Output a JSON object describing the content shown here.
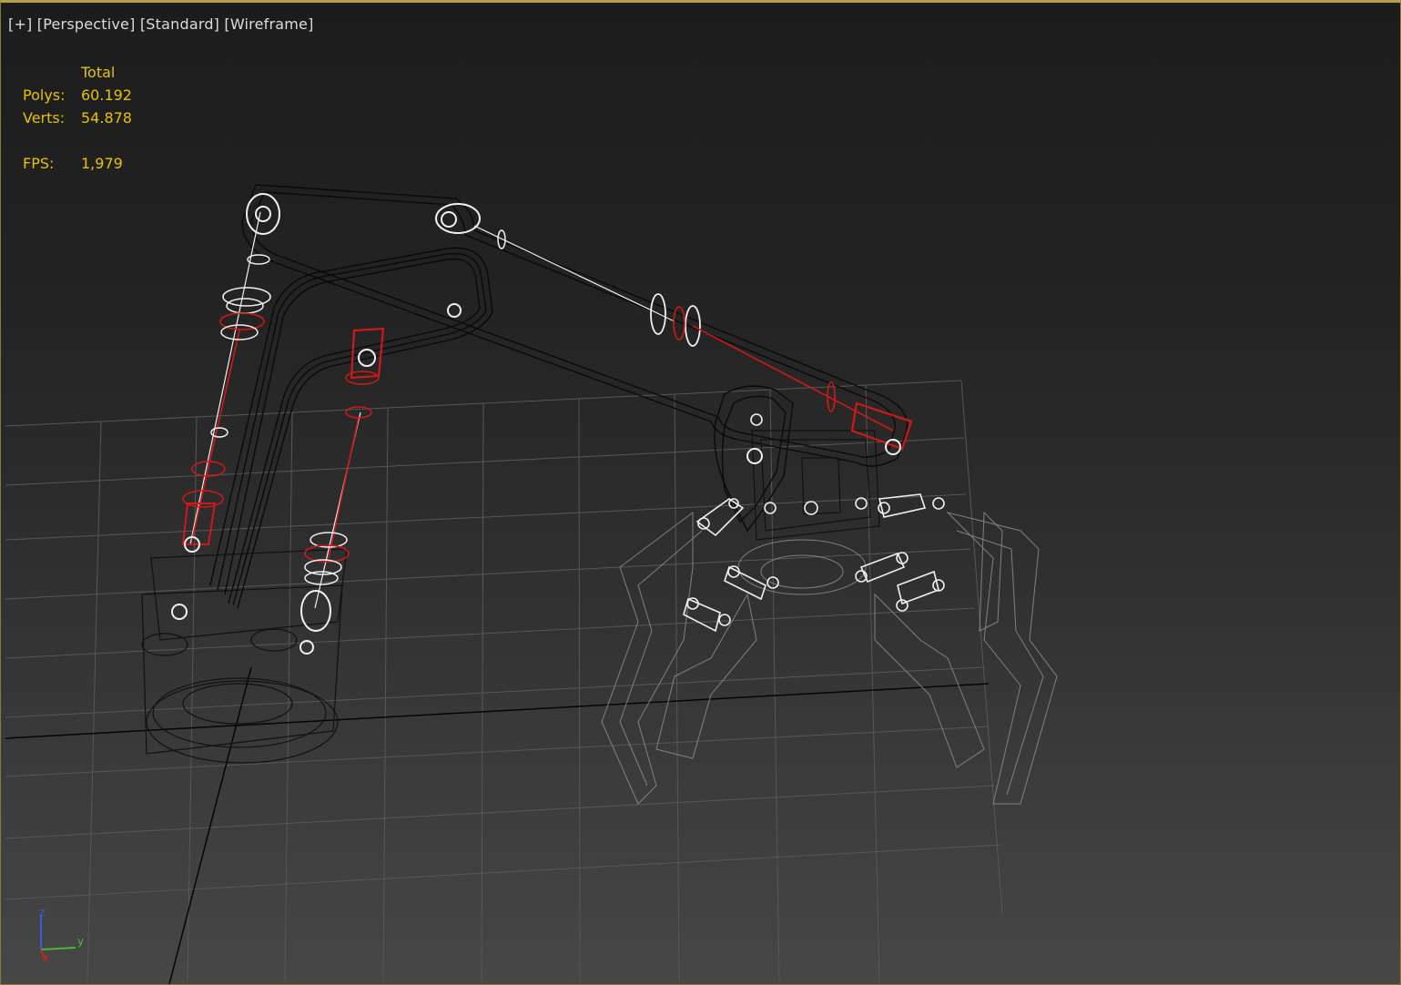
{
  "viewport": {
    "label_plus": "[+]",
    "label_view": "[Perspective]",
    "label_shading": "[Standard]",
    "label_mode": "[Wireframe]"
  },
  "stats": {
    "header": "Total",
    "polys_label": "Polys:",
    "polys_value": "60.192",
    "verts_label": "Verts:",
    "verts_value": "54.878",
    "fps_label": "FPS:",
    "fps_value": "1,979"
  },
  "axis_gizmo": {
    "z": "z",
    "y": "y",
    "x": "x"
  },
  "colors": {
    "frame": "#b8a04a",
    "stats_text": "#e6c200",
    "selected_wire": "#d01818",
    "white_wire": "#f0f0f0",
    "dark_wire": "#0a0a0a",
    "grid": "#5a5a5a"
  }
}
